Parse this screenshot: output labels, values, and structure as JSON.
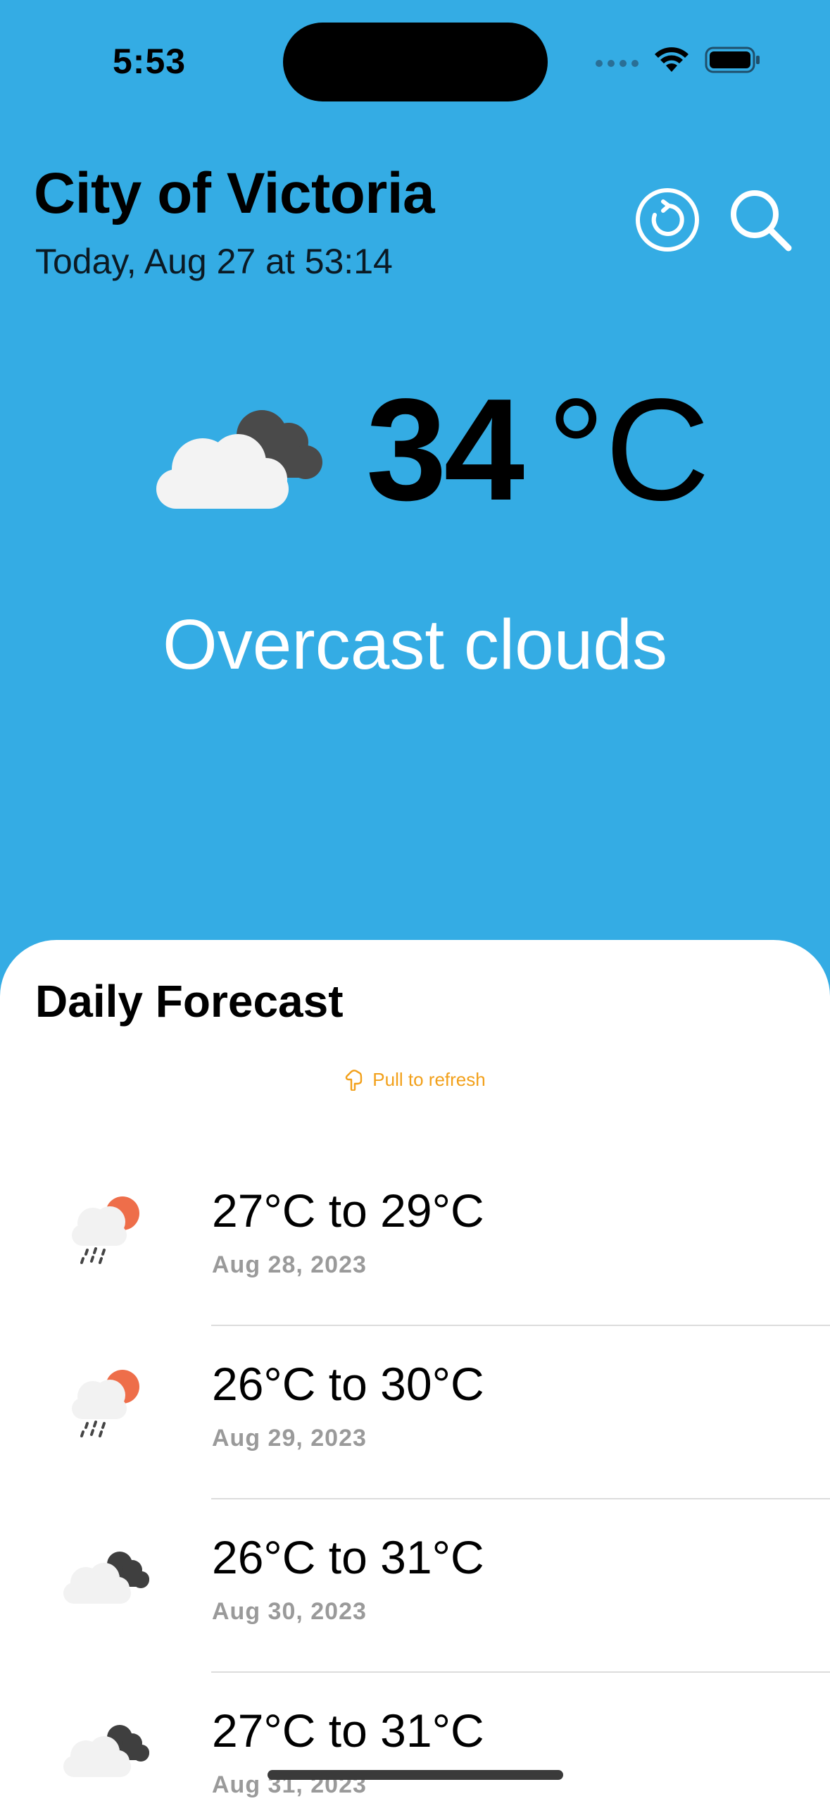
{
  "status_bar": {
    "time": "5:53"
  },
  "header": {
    "city": "City of Victoria",
    "updated": "Today, Aug 27 at 53:14",
    "refresh_icon": "refresh-circle-icon",
    "search_icon": "magnifier-icon"
  },
  "current": {
    "icon": "overcast-clouds-icon",
    "temperature": "34",
    "unit": "°C",
    "description": "Overcast clouds"
  },
  "forecast": {
    "title": "Daily Forecast",
    "pull_to_refresh": "Pull to refresh",
    "days": [
      {
        "range": "27°C to 29°C",
        "date": "Aug 28, 2023",
        "icon": "rain-sun-cloud-icon"
      },
      {
        "range": "26°C to 30°C",
        "date": "Aug 29, 2023",
        "icon": "rain-sun-cloud-icon"
      },
      {
        "range": "26°C to 31°C",
        "date": "Aug 30, 2023",
        "icon": "overcast-clouds-icon"
      },
      {
        "range": "27°C to 31°C",
        "date": "Aug 31, 2023",
        "icon": "overcast-clouds-icon"
      }
    ]
  },
  "colors": {
    "background": "#34ace4",
    "sheet": "#ffffff",
    "accent_orange": "#f2a01a",
    "secondary_text": "#9a9a9a"
  }
}
